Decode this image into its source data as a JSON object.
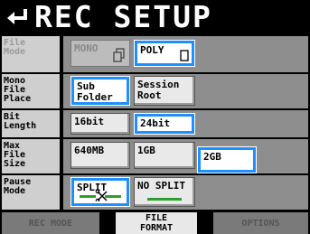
{
  "header": {
    "title": "REC SETUP",
    "back_icon": "return-arrow-icon"
  },
  "rows": {
    "file_mode": {
      "label": [
        "File",
        "Mode"
      ],
      "options": [
        {
          "label": "MONO",
          "icon": "multi-file-icon",
          "state": "disabled"
        },
        {
          "label": "POLY",
          "icon": "single-file-icon",
          "state": "selected"
        }
      ]
    },
    "mono_file_place": {
      "label": [
        "Mono",
        "File",
        "Place"
      ],
      "options": [
        {
          "label": [
            "Sub",
            "Folder"
          ],
          "state": "selected"
        },
        {
          "label": [
            "Session",
            "Root"
          ],
          "state": "normal"
        }
      ]
    },
    "bit_length": {
      "label": [
        "Bit",
        "Length"
      ],
      "options": [
        {
          "label": "16bit",
          "state": "normal"
        },
        {
          "label": "24bit",
          "state": "selected"
        }
      ]
    },
    "max_file_size": {
      "label": [
        "Max",
        "File",
        "Size"
      ],
      "options": [
        {
          "label": "640MB",
          "state": "normal"
        },
        {
          "label": "1GB",
          "state": "normal"
        },
        {
          "label": "2GB",
          "state": "selected"
        }
      ]
    },
    "pause_mode": {
      "label": [
        "Pause",
        "Mode"
      ],
      "options": [
        {
          "label": "SPLIT",
          "icon": "split-scissors-icon",
          "state": "selected"
        },
        {
          "label": "NO SPLIT",
          "icon": "no-split-icon",
          "state": "normal"
        }
      ]
    }
  },
  "tabs": [
    {
      "label": [
        "REC MODE"
      ],
      "state": "inactive"
    },
    {
      "label": [
        "FILE",
        "FORMAT"
      ],
      "state": "active"
    },
    {
      "label": [
        "OPTIONS"
      ],
      "state": "inactive"
    }
  ],
  "colors": {
    "selected": "#1e8fff",
    "row_bg": "#8e8e8e",
    "label_bg": "#cfcfcf",
    "title_bg": "#000000"
  }
}
